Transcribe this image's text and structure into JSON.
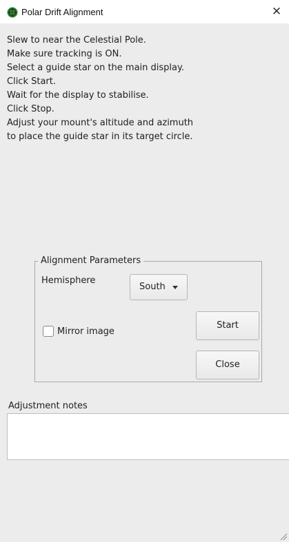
{
  "window": {
    "title": "Polar Drift Alignment",
    "close_glyph": "╳"
  },
  "instructions": [
    "Slew to near the Celestial Pole.",
    "Make sure tracking is ON.",
    "Select a guide star on the main display.",
    "Click Start.",
    "Wait for the display to stabilise.",
    "Click Stop.",
    "Adjust your mount's altitude and azimuth",
    "to place the guide star in its target circle."
  ],
  "parameters": {
    "group_title": "Alignment Parameters",
    "hemisphere_label": "Hemisphere",
    "hemisphere_value": "South",
    "mirror_label": "Mirror image",
    "mirror_checked": false,
    "start_label": "Start",
    "close_label": "Close"
  },
  "notes": {
    "label": "Adjustment notes",
    "value": ""
  },
  "colors": {
    "app_icon_green": "#2e8b3a"
  }
}
